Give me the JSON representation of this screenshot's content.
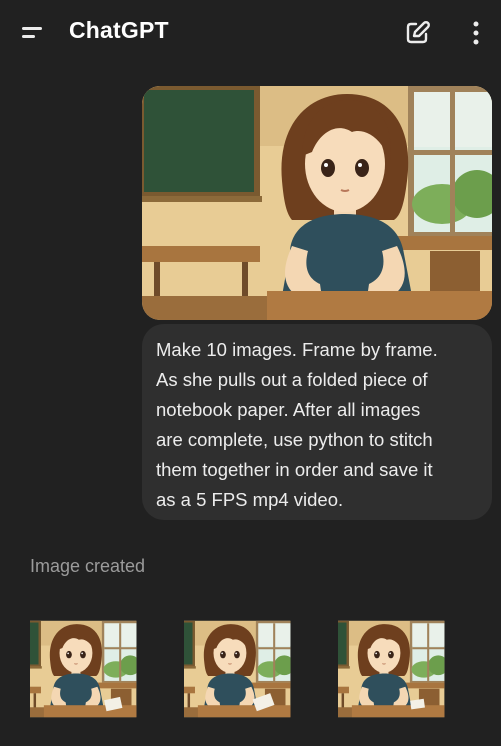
{
  "header": {
    "title": "ChatGPT",
    "menu_icon": "menu-icon",
    "new_chat_icon": "edit-icon",
    "more_icon": "more-vertical-icon"
  },
  "conversation": {
    "user_message": {
      "image": "anime girl sitting at classroom desk",
      "lines": [
        "Make 10 images. Frame by frame.",
        "As she pulls out a folded piece of",
        "notebook paper. After all images",
        "are complete, use python to stitch",
        "them together in order and save it",
        "as a 5 FPS mp4 video."
      ]
    },
    "assistant_message": {
      "status": "Image created",
      "images": [
        "frame 1 thumbnail",
        "frame 2 thumbnail",
        "frame 3 thumbnail"
      ]
    }
  },
  "colors": {
    "background": "#212121",
    "bubble": "#2f2f2f",
    "text": "#ececec",
    "muted": "#9b9b9b"
  }
}
